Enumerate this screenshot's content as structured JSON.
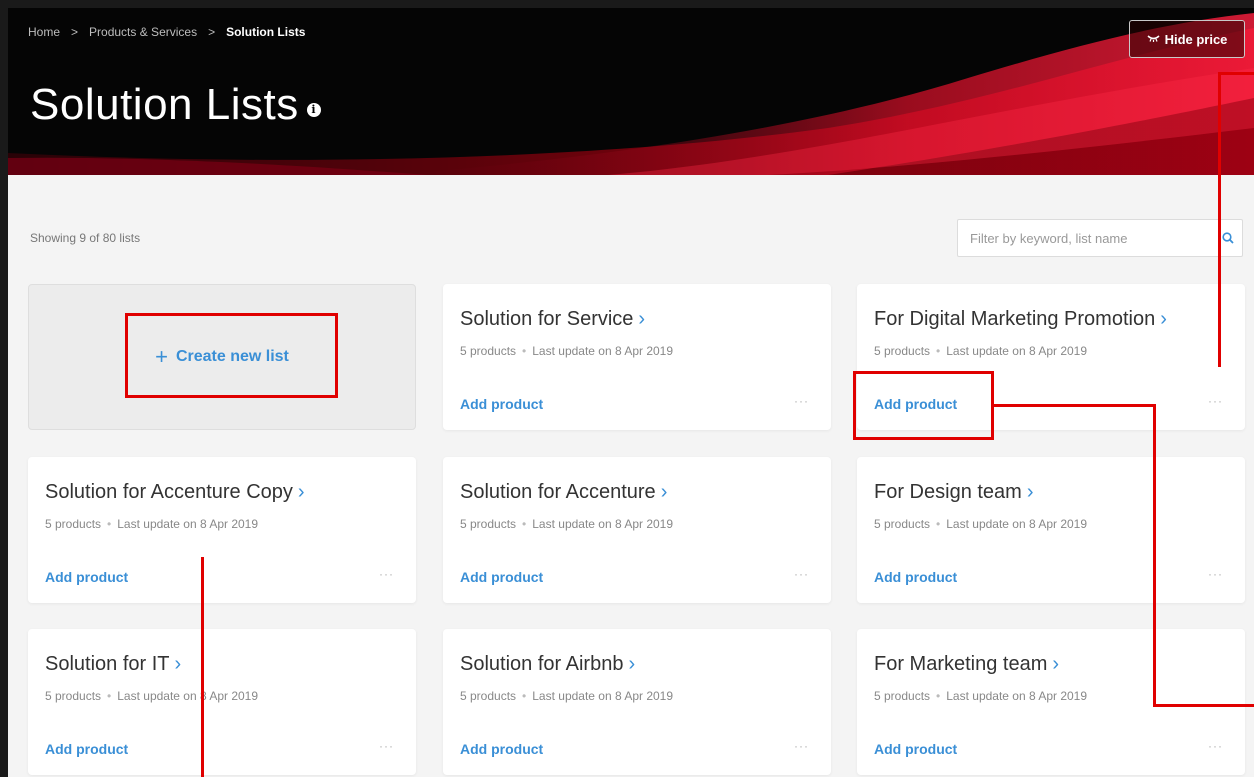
{
  "breadcrumb": {
    "items": [
      "Home",
      "Products & Services"
    ],
    "current": "Solution Lists",
    "separator": ">"
  },
  "header": {
    "title": "Solution Lists",
    "info_glyph": "i",
    "hide_price_label": "Hide price",
    "hide_price_icon": "eye-closed-icon"
  },
  "toolbar": {
    "showing_text": "Showing 9 of 80 lists",
    "filter_placeholder": "Filter by keyword, list name",
    "search_icon": "search-icon"
  },
  "create": {
    "label": "Create new list",
    "plus": "+"
  },
  "cards": [
    {
      "title": "Solution for Service",
      "products": "5 products",
      "updated": "Last update on 8 Apr 2019",
      "action": "Add product",
      "more": "···"
    },
    {
      "title": "For Digital Marketing Promotion",
      "products": "5 products",
      "updated": "Last update on 8 Apr 2019",
      "action": "Add product",
      "more": "···"
    },
    {
      "title": "Solution for Accenture Copy",
      "products": "5 products",
      "updated": "Last update on 8 Apr 2019",
      "action": "Add product",
      "more": "···"
    },
    {
      "title": "Solution for Accenture",
      "products": "5 products",
      "updated": "Last update on 8 Apr 2019",
      "action": "Add product",
      "more": "···"
    },
    {
      "title": "For Design team",
      "products": "5 products",
      "updated": "Last update on 8 Apr 2019",
      "action": "Add product",
      "more": "···"
    },
    {
      "title": "Solution for IT",
      "products": "5 products",
      "updated": "Last update on 8 Apr 2019",
      "action": "Add product",
      "more": "···"
    },
    {
      "title": "Solution for Airbnb",
      "products": "5 products",
      "updated": "Last update on 8 Apr 2019",
      "action": "Add product",
      "more": "···"
    },
    {
      "title": "For Marketing team",
      "products": "5 products",
      "updated": "Last update on 8 Apr 2019",
      "action": "Add product",
      "more": "···"
    }
  ],
  "colors": {
    "accent": "#3a8fd6",
    "annotation": "#e00000",
    "hero_bg": "#050505",
    "hero_swoosh": "#c00010"
  }
}
